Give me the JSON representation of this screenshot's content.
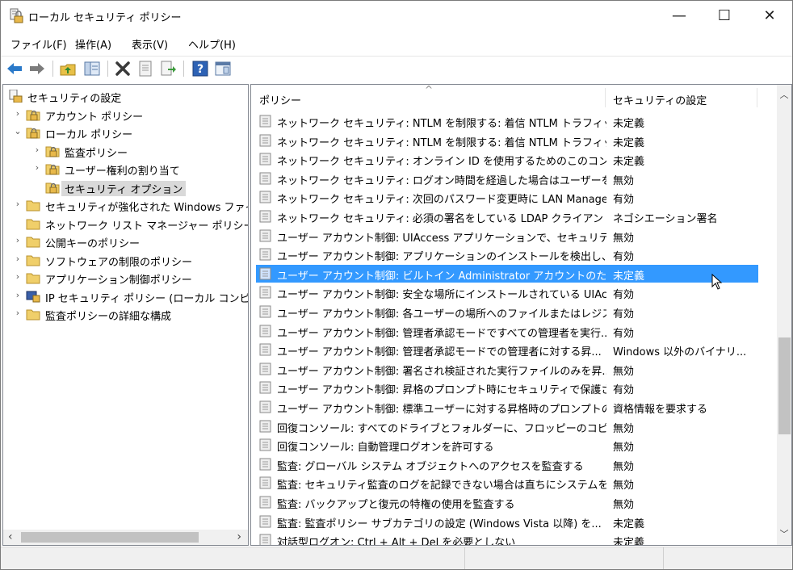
{
  "window": {
    "title": "ローカル セキュリティ ポリシー",
    "minimize": "—",
    "maximize": "☐",
    "close": "✕"
  },
  "menu": [
    {
      "label": "ファイル(F)"
    },
    {
      "label": "操作(A)"
    },
    {
      "label": "表示(V)"
    },
    {
      "label": "ヘルプ(H)"
    }
  ],
  "toolbar": {
    "icons": [
      "back-arrow-icon",
      "forward-arrow-icon",
      "up-folder-icon",
      "show-hide-tree-icon",
      "delete-icon",
      "properties-icon",
      "export-list-icon",
      "help-icon",
      "console-view-icon"
    ]
  },
  "tree": {
    "items": [
      {
        "label": "セキュリティの設定",
        "level": 0,
        "arrow": ""
      },
      {
        "label": "アカウント ポリシー",
        "level": 1,
        "arrow": "›"
      },
      {
        "label": "ローカル ポリシー",
        "level": 1,
        "arrow": "⌄"
      },
      {
        "label": "監査ポリシー",
        "level": 2,
        "arrow": "›"
      },
      {
        "label": "ユーザー権利の割り当て",
        "level": 2,
        "arrow": "›"
      },
      {
        "label": "セキュリティ オプション",
        "level": 2,
        "arrow": "",
        "selected": true
      },
      {
        "label": "セキュリティが強化された Windows ファイアウォール",
        "level": 1,
        "arrow": "›"
      },
      {
        "label": "ネットワーク リスト マネージャー ポリシー",
        "level": 1,
        "arrow": ""
      },
      {
        "label": "公開キーのポリシー",
        "level": 1,
        "arrow": "›"
      },
      {
        "label": "ソフトウェアの制限のポリシー",
        "level": 1,
        "arrow": "›"
      },
      {
        "label": "アプリケーション制御ポリシー",
        "level": 1,
        "arrow": "›"
      },
      {
        "label": "IP セキュリティ ポリシー (ローカル コンピューター)",
        "level": 1,
        "arrow": "›"
      },
      {
        "label": "監査ポリシーの詳細な構成",
        "level": 1,
        "arrow": "›"
      }
    ]
  },
  "list": {
    "columns": {
      "policy": "ポリシー",
      "setting": "セキュリティの設定",
      "sort_indicator": "^"
    },
    "rows": [
      {
        "policy": "ネットワーク セキュリティ: NTLM を制限する: 着信 NTLM トラフィック",
        "setting": "未定義"
      },
      {
        "policy": "ネットワーク セキュリティ: NTLM を制限する: 着信 NTLM トラフィック...",
        "setting": "未定義"
      },
      {
        "policy": "ネットワーク セキュリティ: オンライン ID を使用するためのこのコンピュー...",
        "setting": "未定義"
      },
      {
        "policy": "ネットワーク セキュリティ: ログオン時間を経過した場合はユーザーを強...",
        "setting": "無効"
      },
      {
        "policy": "ネットワーク セキュリティ: 次回のパスワード変更時に LAN Manager ...",
        "setting": "有効"
      },
      {
        "policy": "ネットワーク セキュリティ: 必須の署名をしている LDAP クライアント",
        "setting": "ネゴシエーション署名"
      },
      {
        "policy": "ユーザー アカウント制御: UIAccess アプリケーションで、セキュリティで...",
        "setting": "無効"
      },
      {
        "policy": "ユーザー アカウント制御: アプリケーションのインストールを検出し、昇...",
        "setting": "有効"
      },
      {
        "policy": "ユーザー アカウント制御: ビルトイン Administrator アカウントのための...",
        "setting": "未定義",
        "selected": true
      },
      {
        "policy": "ユーザー アカウント制御: 安全な場所にインストールされている UIAcc...",
        "setting": "有効"
      },
      {
        "policy": "ユーザー アカウント制御: 各ユーザーの場所へのファイルまたはレジスト...",
        "setting": "有効"
      },
      {
        "policy": "ユーザー アカウント制御: 管理者承認モードですべての管理者を実行...",
        "setting": "有効"
      },
      {
        "policy": "ユーザー アカウント制御: 管理者承認モードでの管理者に対する昇...",
        "setting": "Windows 以外のバイナリ..."
      },
      {
        "policy": "ユーザー アカウント制御: 署名され検証された実行ファイルのみを昇...",
        "setting": "無効"
      },
      {
        "policy": "ユーザー アカウント制御: 昇格のプロンプト時にセキュリティで保護され...",
        "setting": "有効"
      },
      {
        "policy": "ユーザー アカウント制御: 標準ユーザーに対する昇格時のプロンプトの...",
        "setting": "資格情報を要求する"
      },
      {
        "policy": "回復コンソール: すべてのドライブとフォルダーに、フロッピーのコピーとアク...",
        "setting": "無効"
      },
      {
        "policy": "回復コンソール: 自動管理ログオンを許可する",
        "setting": "無効"
      },
      {
        "policy": "監査: グローバル システム オブジェクトへのアクセスを監査する",
        "setting": "無効"
      },
      {
        "policy": "監査: セキュリティ監査のログを記録できない場合は直ちにシステムを...",
        "setting": "無効"
      },
      {
        "policy": "監査: バックアップと復元の特権の使用を監査する",
        "setting": "無効"
      },
      {
        "policy": "監査: 監査ポリシー サブカテゴリの設定 (Windows Vista 以降) を...",
        "setting": "未定義"
      },
      {
        "policy": "対話型ログオン: Ctrl + Alt + Del を必要としない",
        "setting": "未定義"
      }
    ]
  },
  "scrollbar": {
    "position": 0.72
  }
}
